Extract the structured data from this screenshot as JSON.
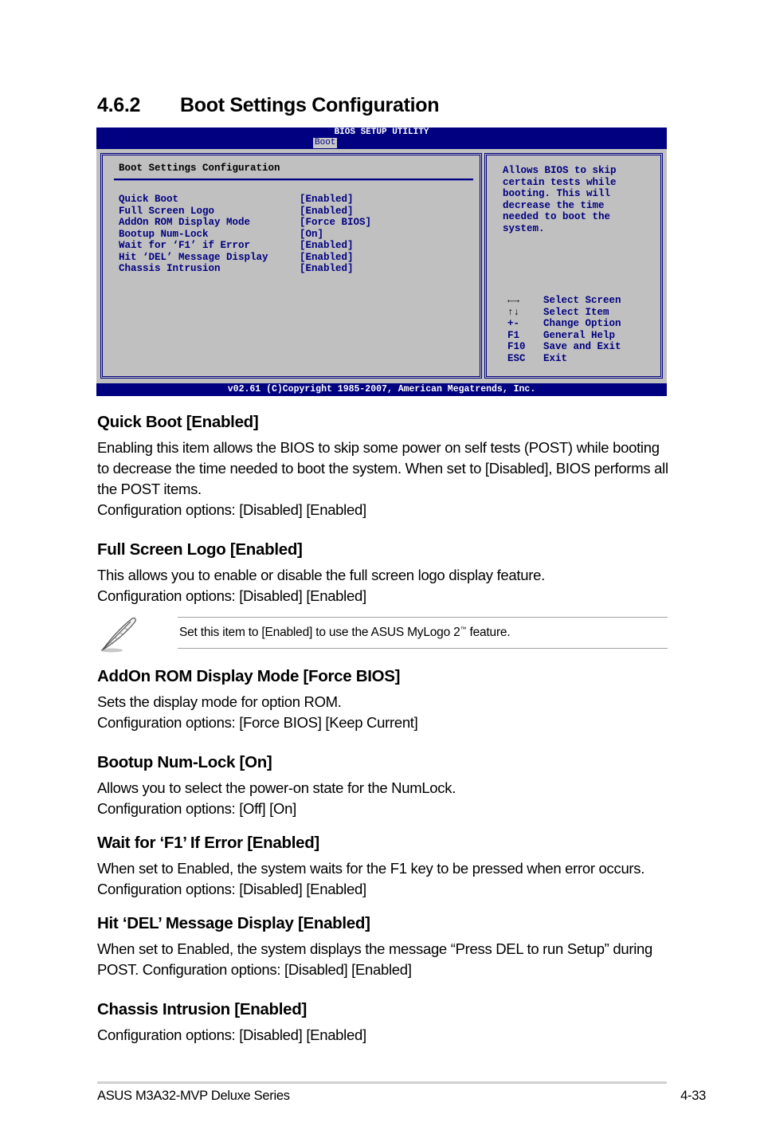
{
  "section": {
    "number": "4.6.2",
    "title": "Boot Settings Configuration"
  },
  "bios": {
    "title": "BIOS SETUP UTILITY",
    "active_tab": "Boot",
    "panel_heading": "Boot Settings Configuration",
    "items": [
      {
        "label": "Quick Boot",
        "value": "[Enabled]"
      },
      {
        "label": "Full Screen Logo",
        "value": "[Enabled]"
      },
      {
        "label": "AddOn ROM Display Mode",
        "value": "[Force BIOS]"
      },
      {
        "label": "Bootup Num-Lock",
        "value": "[On]"
      },
      {
        "label": "Wait for ‘F1’ if Error",
        "value": "[Enabled]"
      },
      {
        "label": "Hit ‘DEL’ Message Display",
        "value": "[Enabled]"
      },
      {
        "label": "Chassis Intrusion",
        "value": "[Enabled]"
      }
    ],
    "help_text": "Allows BIOS to skip\ncertain tests while\nbooting. This will\ndecrease the time\nneeded to boot the\nsystem.",
    "keys": [
      {
        "key": "←→",
        "icon": "left-right-arrows-icon",
        "action": "Select Screen"
      },
      {
        "key": "↑↓",
        "icon": "up-down-arrows-icon",
        "action": "Select Item"
      },
      {
        "key": "+-",
        "action": "Change Option"
      },
      {
        "key": "F1",
        "action": "General Help"
      },
      {
        "key": "F10",
        "action": "Save and Exit"
      },
      {
        "key": "ESC",
        "action": "Exit"
      }
    ],
    "footer": "v02.61 (C)Copyright 1985-2007, American Megatrends, Inc."
  },
  "sections": [
    {
      "heading": "Quick Boot [Enabled]",
      "body": [
        "Enabling this item allows the BIOS to skip some power on self tests (POST) while booting to decrease the time needed to boot the system. When set to [Disabled], BIOS performs all the POST items.",
        "Configuration options: [Disabled] [Enabled]"
      ]
    },
    {
      "heading": "Full Screen Logo [Enabled]",
      "body": [
        "This allows you to enable or disable the full screen logo display feature.",
        "Configuration options: [Disabled] [Enabled]"
      ]
    },
    {
      "heading": "AddOn ROM Display Mode [Force BIOS]",
      "body": [
        "Sets the display mode for option ROM.",
        "Configuration options: [Force BIOS] [Keep Current]"
      ]
    },
    {
      "heading": "Bootup Num-Lock [On]",
      "body": [
        "Allows you to select the power-on state for the NumLock.",
        "Configuration options: [Off] [On]"
      ]
    },
    {
      "heading": "Wait for ‘F1’ If Error [Enabled]",
      "body": [
        "When set to Enabled, the system waits for the F1 key to be pressed when error occurs. Configuration options: [Disabled] [Enabled]"
      ]
    },
    {
      "heading": "Hit ‘DEL’ Message Display [Enabled]",
      "body": [
        "When set to Enabled, the system displays the message “Press DEL to run Setup” during POST. Configuration options: [Disabled] [Enabled]"
      ]
    },
    {
      "heading": "Chassis Intrusion [Enabled]",
      "body": [
        "Configuration options: [Disabled] [Enabled]"
      ]
    }
  ],
  "note": {
    "icon": "feather-pen-icon",
    "text_before": "Set this item to [Enabled] to use the ASUS MyLogo 2",
    "trademark": "™",
    "text_after": " feature."
  },
  "footer": {
    "left": "ASUS M3A32-MVP Deluxe Series",
    "right": "4-33"
  }
}
